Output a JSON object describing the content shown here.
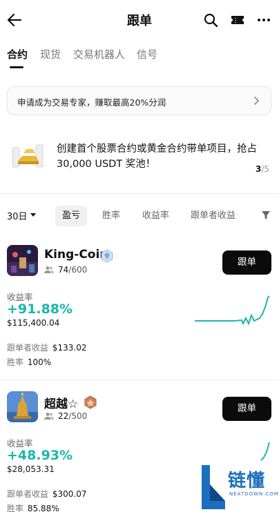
{
  "header": {
    "title": "跟单"
  },
  "tabs": [
    "合约",
    "现货",
    "交易机器人",
    "信号"
  ],
  "banner": {
    "text": "申请成为交易专家，赚取最高20%分润"
  },
  "promo": {
    "text": "创建首个股票合约或黄金合约带单项目，抢占 30,000 USDT 奖池！",
    "page_current": "3",
    "page_total": "/5"
  },
  "filters": {
    "period": "30日",
    "chips": [
      "盈亏",
      "胜率",
      "收益率",
      "跟单者收益"
    ]
  },
  "traders": [
    {
      "name": "King-Coin",
      "followers": "74",
      "followers_max": "/600",
      "follow_label": "跟单",
      "roi_label": "收益率",
      "roi": "+91.88%",
      "pnl": "$115,400.04",
      "follower_profit_label": "跟单者收益",
      "follower_profit": "$133.02",
      "winrate_label": "胜率",
      "winrate": "100%"
    },
    {
      "name": "超越☆",
      "followers": "22",
      "followers_max": "/500",
      "follow_label": "跟单",
      "roi_label": "收益率",
      "roi": "+48.93%",
      "pnl": "$28,053.31",
      "follower_profit_label": "跟单者收益",
      "follower_profit": "$300.07",
      "winrate_label": "胜率",
      "winrate": "85.88%"
    }
  ],
  "watermark": {
    "text": "链懂",
    "sub": "NEATDOWN.COM"
  },
  "colors": {
    "accent": "#19b8a8",
    "button": "#0b0b0b"
  }
}
